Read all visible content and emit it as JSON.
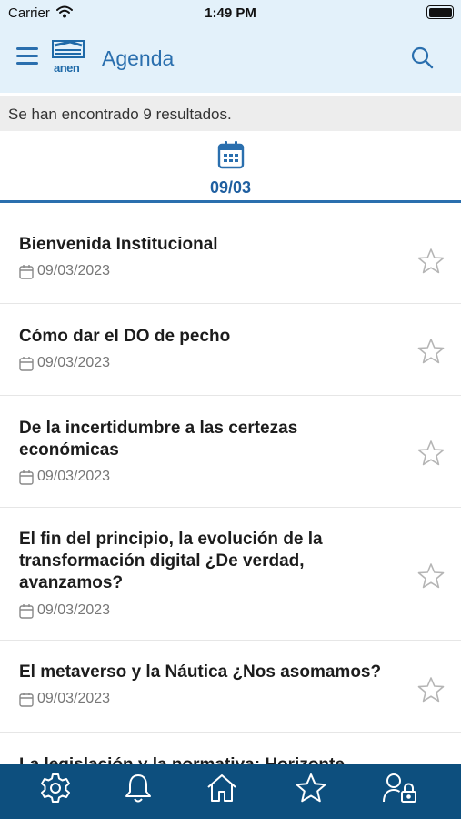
{
  "status_bar": {
    "carrier": "Carrier",
    "time": "1:49 PM"
  },
  "header": {
    "title": "Agenda",
    "logo_text": "anen"
  },
  "results": {
    "text": "Se han encontrado 9 resultados."
  },
  "date_tab": {
    "label": "09/03"
  },
  "items": [
    {
      "title": "Bienvenida Institucional",
      "date": "09/03/2023"
    },
    {
      "title": "Cómo dar el DO de pecho",
      "date": "09/03/2023"
    },
    {
      "title": "De la incertidumbre a las certezas económicas",
      "date": "09/03/2023"
    },
    {
      "title": "El fin del principio, la evolución de la transformación digital ¿De verdad, avanzamos?",
      "date": "09/03/2023"
    },
    {
      "title": "El metaverso y la Náutica ¿Nos asomamos?",
      "date": "09/03/2023"
    },
    {
      "title": "La legislación y la normativa: Horizonte",
      "date": ""
    }
  ],
  "tab_bar": {
    "icons": [
      "gear-icon",
      "bell-icon",
      "home-icon",
      "star-icon",
      "user-lock-icon"
    ]
  },
  "colors": {
    "accent": "#2a6fae",
    "header_bg": "#e3f1fa",
    "tab_bar_bg": "#0d4f7e",
    "results_bg": "#ededed"
  }
}
